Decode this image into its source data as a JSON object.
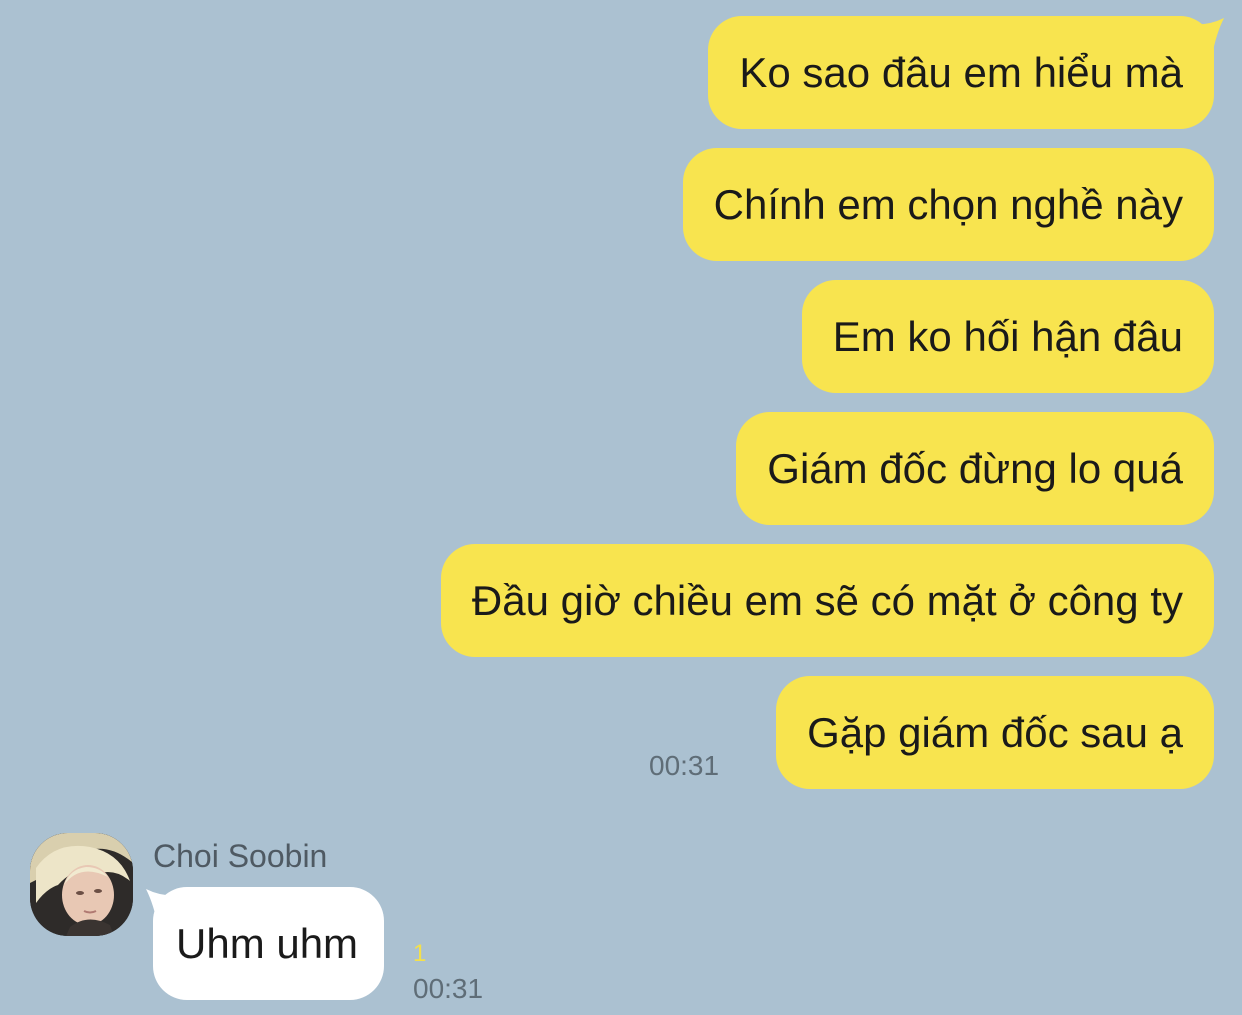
{
  "messages_out": [
    {
      "text": "Ko sao đâu em hiểu mà"
    },
    {
      "text": "Chính em chọn nghề này"
    },
    {
      "text": "Em ko hối hận đâu"
    },
    {
      "text": "Giám đốc đừng lo quá"
    },
    {
      "text": "Đầu giờ chiều em sẽ có mặt ở công ty"
    },
    {
      "text": "Gặp giám đốc sau ạ"
    }
  ],
  "out_time": "00:31",
  "incoming": {
    "sender": "Choi Soobin",
    "text": "Uhm uhm",
    "unread": "1",
    "time": "00:31"
  },
  "colors": {
    "background": "#abc1d1",
    "outgoing_bubble": "#f8e44f",
    "incoming_bubble": "#ffffff"
  }
}
